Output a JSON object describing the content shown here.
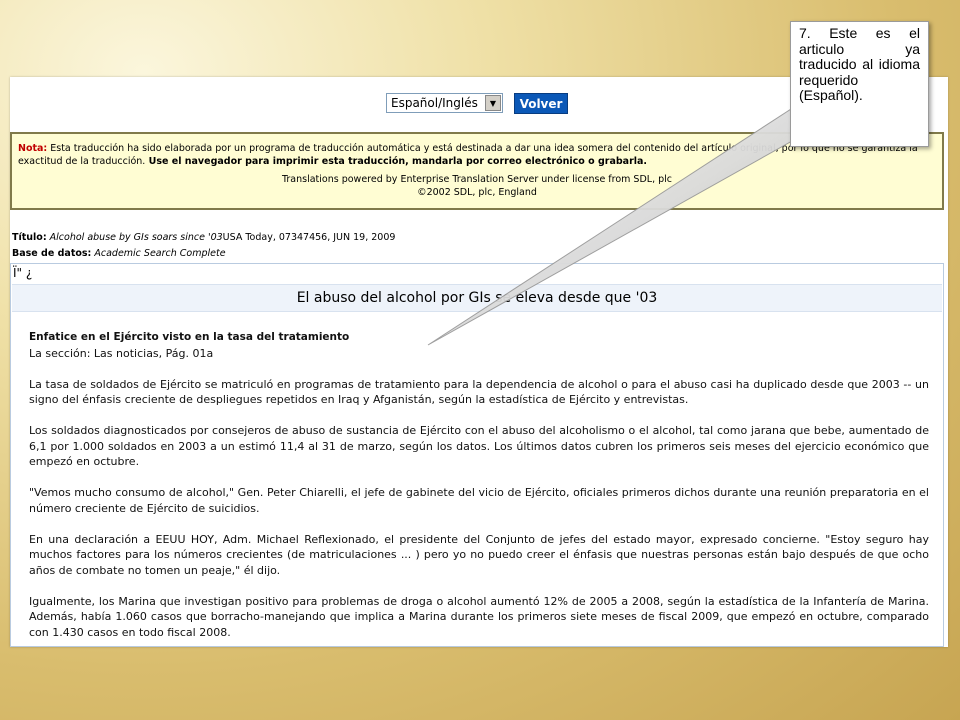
{
  "toolbar": {
    "language_selected": "Español/Inglés",
    "go_label": "Volver"
  },
  "note": {
    "label": "Nota:",
    "text": " Esta traducción ha sido elaborada por un programa de traducción automática y está destinada a dar una idea somera del contenido del artículo original, por lo que no se garantiza la exactitud de la traducción.",
    "bold_text": " Use el navegador para imprimir esta traducción, mandarla por correo electrónico o grabarla.",
    "credit_line1": "Translations powered by Enterprise Translation Server under license from SDL, plc",
    "credit_line2": "©2002 SDL, plc, England"
  },
  "meta": {
    "title_label": "Título:",
    "title_value": "Alcohol abuse by GIs soars since '03",
    "source": "USA Today, 07347456, JUN 19, 2009",
    "db_label": "Base de datos:",
    "db_value": "Academic Search Complete"
  },
  "article": {
    "garbled": "Ï\" ¿",
    "title": "El abuso del alcohol por GIs se eleva desde que '03",
    "subtitle": "Enfatice en el Ejército visto en la tasa del tratamiento",
    "section": "La sección: Las noticias, Pág. 01a",
    "paragraphs": [
      "La tasa de soldados de Ejército se matriculó en programas de tratamiento para la dependencia de alcohol o para el abuso casi ha duplicado desde que 2003 -- un signo del énfasis creciente de despliegues repetidos en Iraq y Afganistán, según la estadística de Ejército y entrevistas.",
      "Los soldados diagnosticados por consejeros de abuso de sustancia de Ejército con el abuso del alcoholismo o el alcohol, tal como jarana que bebe, aumentado de 6,1 por 1.000 soldados en 2003 a un estimó 11,4 al 31 de marzo, según los datos. Los últimos datos cubren los primeros seis meses del ejercicio económico que empezó en octubre.",
      "\"Vemos mucho consumo de alcohol,\" Gen. Peter Chiarelli, el jefe de gabinete del vicio de Ejército, oficiales primeros dichos durante una reunión preparatoria en el número creciente de Ejército de suicidios.",
      "En una declaración a EEUU HOY, Adm. Michael Reflexionado, el presidente del Conjunto de jefes del estado mayor, expresado concierne. \"Estoy seguro hay muchos factores para los números crecientes (de matriculaciones ... ) pero yo no puedo creer el énfasis que nuestras personas están bajo después de que ocho años de combate no tomen un peaje,\" él dijo.",
      "Igualmente, los Marina que investigan positivo para problemas de droga o alcohol aumentó 12% de 2005 a 2008, según la estadística de la Infantería de Marina. Además, había 1.060 casos que borracho-manejando que implica a Marina durante los primeros siete meses de fiscal 2009, que empezó en octubre, comparado con 1.430 casos en todo fiscal 2008."
    ]
  },
  "callout": {
    "text": "7. Este es el articulo ya traducido al idioma requerido (Español)."
  }
}
